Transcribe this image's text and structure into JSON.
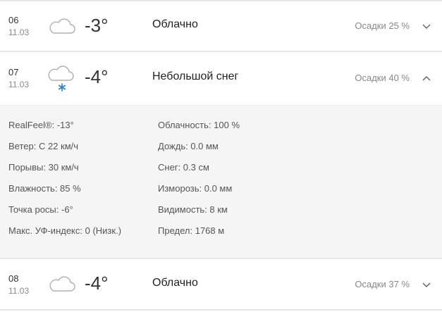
{
  "forecast": [
    {
      "hour": "06",
      "date": "11.03",
      "icon": "cloud-icon",
      "temp": "-3°",
      "phrase": "Облачно",
      "precip": "Осадки 25 %",
      "expanded": false
    },
    {
      "hour": "07",
      "date": "11.03",
      "icon": "cloud-snow-icon",
      "temp": "-4°",
      "phrase": "Небольшой снег",
      "precip": "Осадки 40 %",
      "expanded": true
    },
    {
      "hour": "08",
      "date": "11.03",
      "icon": "cloud-icon",
      "temp": "-4°",
      "phrase": "Облачно",
      "precip": "Осадки 37 %",
      "expanded": false
    }
  ],
  "details": {
    "left": [
      "RealFeel®: -13°",
      "Ветер: С 22 км/ч",
      "Порывы: 30 км/ч",
      "Влажность: 85 %",
      "Точка росы: -6°",
      "Макс. УФ-индекс: 0 (Низк.)"
    ],
    "right": [
      "Облачность: 100 %",
      "Дождь: 0.0 мм",
      "Снег: 0.3 см",
      "Изморозь: 0.0 мм",
      "Видимость: 8 км",
      "Предел: 1768 м"
    ]
  },
  "colors": {
    "snowflake": "#2b7fd0",
    "cloud_stroke": "#b0b0b0",
    "details_bg": "#f5f5f5"
  }
}
